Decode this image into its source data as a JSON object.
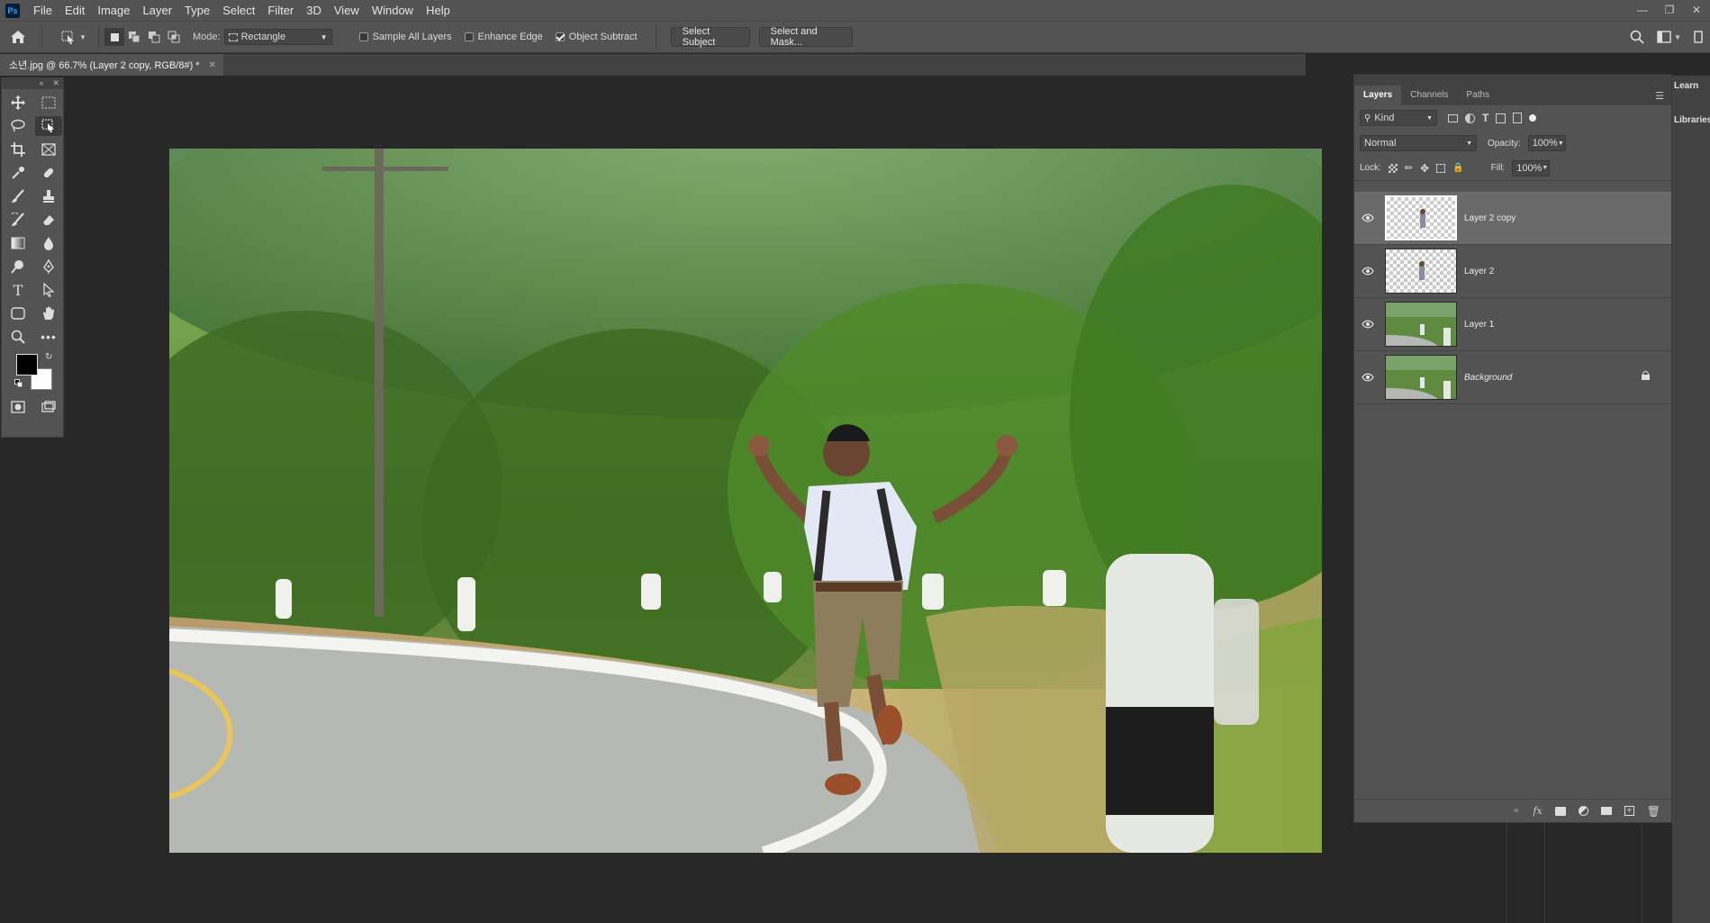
{
  "app": {
    "logo": "Ps"
  },
  "menu": [
    "File",
    "Edit",
    "Image",
    "Layer",
    "Type",
    "Select",
    "Filter",
    "3D",
    "View",
    "Window",
    "Help"
  ],
  "options": {
    "mode_label": "Mode:",
    "mode_value": "Rectangle",
    "sample_all_layers": "Sample All Layers",
    "enhance_edge": "Enhance Edge",
    "object_subtract": "Object Subtract",
    "select_subject": "Select Subject",
    "select_and_mask": "Select and Mask..."
  },
  "document": {
    "tab_title": "소년.jpg @ 66.7% (Layer 2 copy, RGB/8#) *"
  },
  "layers_panel": {
    "tabs": [
      "Layers",
      "Channels",
      "Paths"
    ],
    "filter_kind": "Kind",
    "blend_mode": "Normal",
    "opacity_label": "Opacity:",
    "opacity_value": "100%",
    "lock_label": "Lock:",
    "fill_label": "Fill:",
    "fill_value": "100%",
    "layers": [
      {
        "name": "Layer 2 copy",
        "selected": true,
        "transparent": true
      },
      {
        "name": "Layer 2",
        "selected": false,
        "transparent": true
      },
      {
        "name": "Layer 1",
        "selected": false,
        "transparent": false
      },
      {
        "name": "Background",
        "selected": false,
        "transparent": false,
        "locked": true
      }
    ]
  },
  "side_panels": {
    "learn": "Learn",
    "libraries": "Libraries"
  },
  "colors": {
    "ui_bg": "#535353",
    "canvas_bg": "#282828",
    "accent": "#31a8ff"
  }
}
